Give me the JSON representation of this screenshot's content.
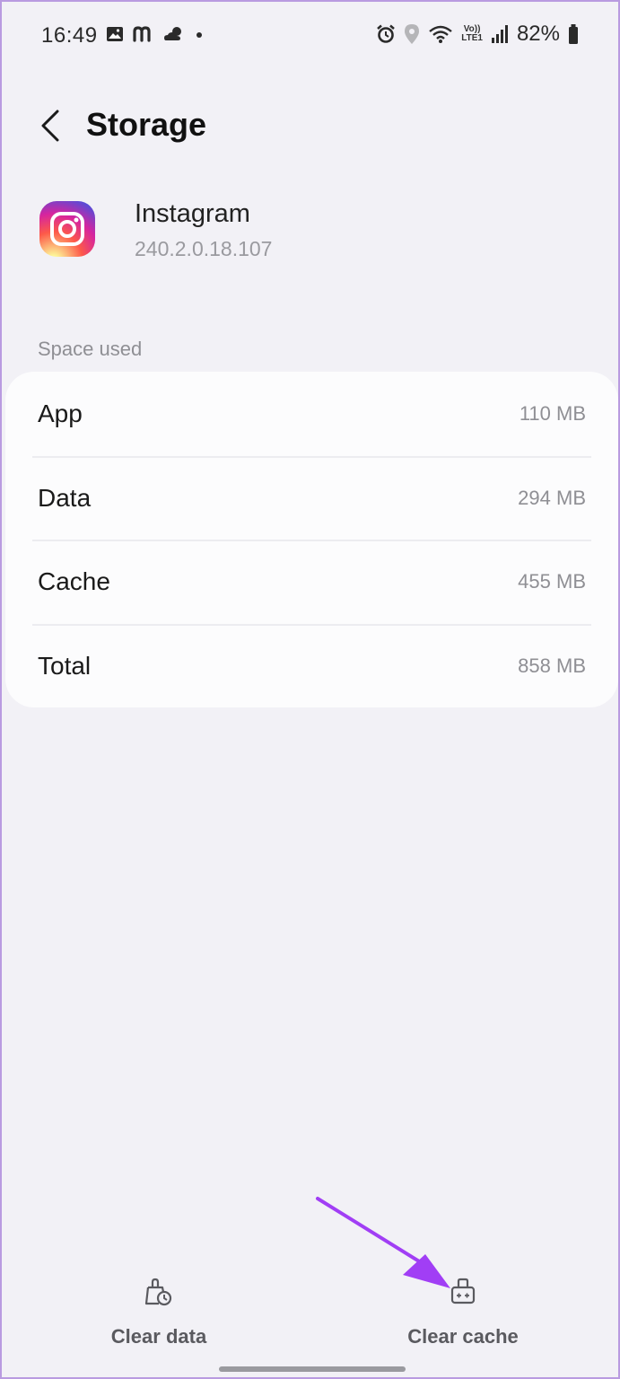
{
  "status_bar": {
    "time": "16:49",
    "volte_top": "Vo))",
    "volte_bottom": "LTE1",
    "battery": "82%"
  },
  "header": {
    "title": "Storage"
  },
  "app": {
    "name": "Instagram",
    "version": "240.2.0.18.107"
  },
  "storage": {
    "section_label": "Space used",
    "rows": [
      {
        "label": "App",
        "value": "110 MB"
      },
      {
        "label": "Data",
        "value": "294 MB"
      },
      {
        "label": "Cache",
        "value": "455 MB"
      },
      {
        "label": "Total",
        "value": "858 MB"
      }
    ]
  },
  "actions": {
    "clear_data": "Clear data",
    "clear_cache": "Clear cache"
  },
  "colors": {
    "background": "#f2f1f6",
    "card": "#fcfcfd",
    "annotation_arrow": "#a13ef5"
  },
  "icons": [
    "back-arrow-icon",
    "gallery-icon",
    "messenger-icon",
    "weather-icon",
    "dot-icon",
    "alarm-icon",
    "location-icon",
    "wifi-icon",
    "signal-icon",
    "battery-icon",
    "instagram-icon",
    "clear-data-icon",
    "clear-cache-icon"
  ]
}
